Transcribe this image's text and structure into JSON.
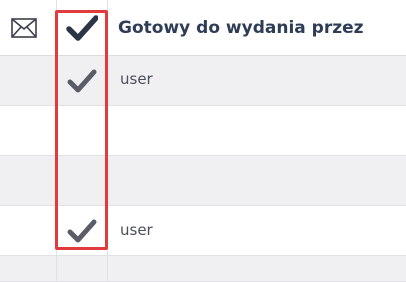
{
  "header": {
    "mail_icon": "envelope-icon",
    "check_icon": "checkmark-icon",
    "column_title": "Gotowy do wydania przez"
  },
  "rows": [
    {
      "checked": true,
      "user": "user"
    },
    {
      "checked": false,
      "user": ""
    },
    {
      "checked": false,
      "user": ""
    },
    {
      "checked": true,
      "user": "user"
    },
    {
      "checked": false,
      "user": ""
    }
  ],
  "colors": {
    "highlight": "#e03c3c",
    "checkmark_header": "#2b3547",
    "checkmark_row": "#5a5d68",
    "header_text": "#2e3d55"
  }
}
